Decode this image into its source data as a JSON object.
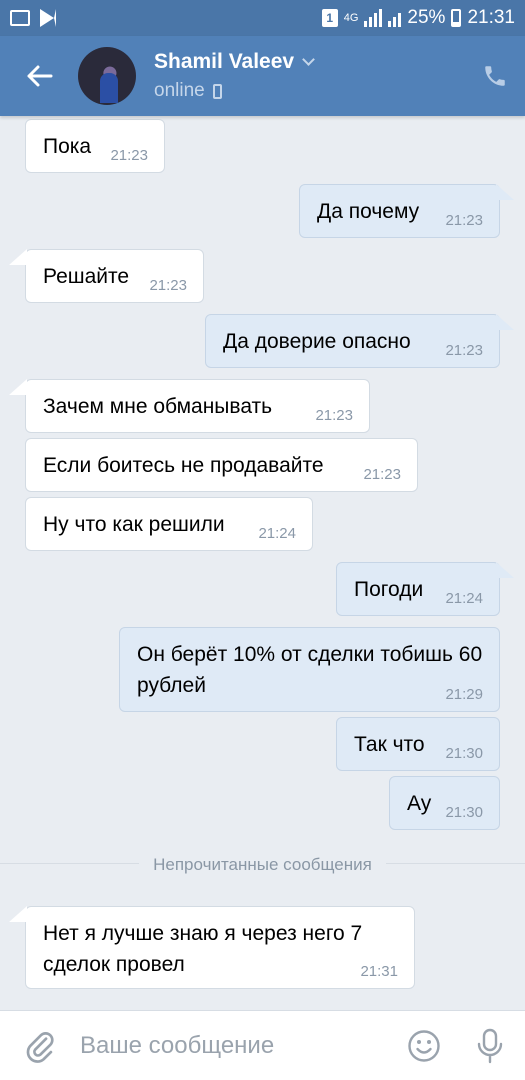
{
  "status_bar": {
    "battery": "25%",
    "time": "21:31",
    "network": "4G"
  },
  "header": {
    "name": "Shamil Valeev",
    "status": "online"
  },
  "messages": [
    {
      "text": "Пока",
      "time": "21:23",
      "dir": "in"
    },
    {
      "text": "Да почему",
      "time": "21:23",
      "dir": "out"
    },
    {
      "text": "Решайте",
      "time": "21:23",
      "dir": "in"
    },
    {
      "text": "Да доверие опасно",
      "time": "21:23",
      "dir": "out"
    },
    {
      "text": "Зачем мне обманывать",
      "time": "21:23",
      "dir": "in"
    },
    {
      "text": "Если боитесь не продавайте",
      "time": "21:23",
      "dir": "in"
    },
    {
      "text": "Ну что как решили",
      "time": "21:24",
      "dir": "in"
    },
    {
      "text": "Погоди",
      "time": "21:24",
      "dir": "out"
    },
    {
      "text": "Он берёт 10% от сделки тобишь 60 рублей",
      "time": "21:29",
      "dir": "out"
    },
    {
      "text": "Так что",
      "time": "21:30",
      "dir": "out"
    },
    {
      "text": "Ау",
      "time": "21:30",
      "dir": "out"
    },
    {
      "text": "Нет я лучше знаю я через него 7 сделок провел",
      "time": "21:31",
      "dir": "in"
    }
  ],
  "unread_divider": "Непрочитанные сообщения",
  "composer": {
    "placeholder": "Ваше сообщение"
  },
  "colors": {
    "header": "#5181b8",
    "status_bar": "#4a76a8",
    "background": "#e9edf2",
    "incoming_bubble": "#ffffff",
    "outgoing_bubble": "#dfeaf6"
  }
}
